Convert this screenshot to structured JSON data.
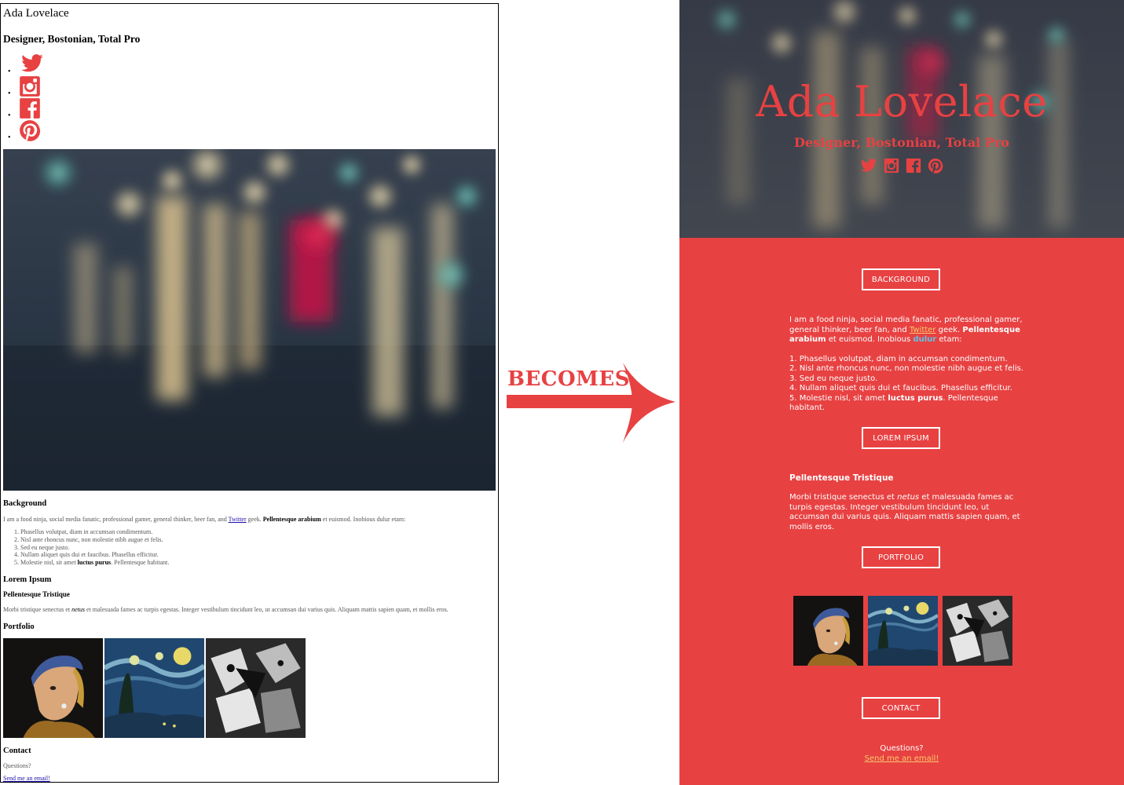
{
  "profile": {
    "name": "Ada Lovelace",
    "tagline": "Designer, Bostonian, Total Pro"
  },
  "social": [
    "twitter-icon",
    "instagram-icon",
    "facebook-icon",
    "pinterest-icon"
  ],
  "colors": {
    "accent": "#e84142",
    "link_left": "#1a0dab",
    "link_right": "#f7c96b",
    "highlight": "#5ec3e8"
  },
  "arrow": {
    "label": "BECOMES"
  },
  "sections": {
    "background": {
      "heading_left": "Background",
      "heading_right": "BACKGROUND"
    },
    "lorem": {
      "heading_left": "Lorem Ipsum",
      "heading_right": "LOREM IPSUM"
    },
    "portfolio": {
      "heading_left": "Portfolio",
      "heading_right": "PORTFOLIO"
    },
    "contact": {
      "heading_left": "Contact",
      "heading_right": "CONTACT"
    }
  },
  "about": {
    "intro_start": "I am a food ninja, social media fanatic, professional gamer, general thinker, beer fan, and ",
    "link": "Twitter",
    "intro_mid": " geek. ",
    "bold": "Pellentesque arabium",
    "intro_end_left": " et euismod. Inobious dulur etam:",
    "intro_end_right_a": " et euismod. Inobious ",
    "highlight": "dulur",
    "intro_end_right_b": " etam:",
    "list": [
      {
        "num": "1.",
        "text": "Phasellus volutpat, diam in accumsan condimentum."
      },
      {
        "num": "2.",
        "text": "Nisl ante rhoncus nunc, non molestie nibh augue et felis."
      },
      {
        "num": "3.",
        "text": "Sed eu neque justo."
      },
      {
        "num": "4.",
        "text": "Nullam aliquet quis dui et faucibus. Phasellus efficitur."
      },
      {
        "num": "5.",
        "text_a": "Molestie nisl, sit amet ",
        "bold": "luctus purus",
        "text_b": ". Pellentesque habitant."
      }
    ]
  },
  "lorem_block": {
    "subheading": "Pellentesque Tristique",
    "text_a": "Morbi tristique senectus et ",
    "italic": "netus",
    "text_b": " et malesuada fames ac turpis egestas. Integer vestibulum tincidunt leo, ut accumsan dui varius quis. Aliquam mattis sapien quam, et mollis eros."
  },
  "artworks": [
    "girl-with-pearl-earring",
    "starry-night",
    "guernica"
  ],
  "contact": {
    "question": "Questions?",
    "link": "Send me an email!"
  }
}
